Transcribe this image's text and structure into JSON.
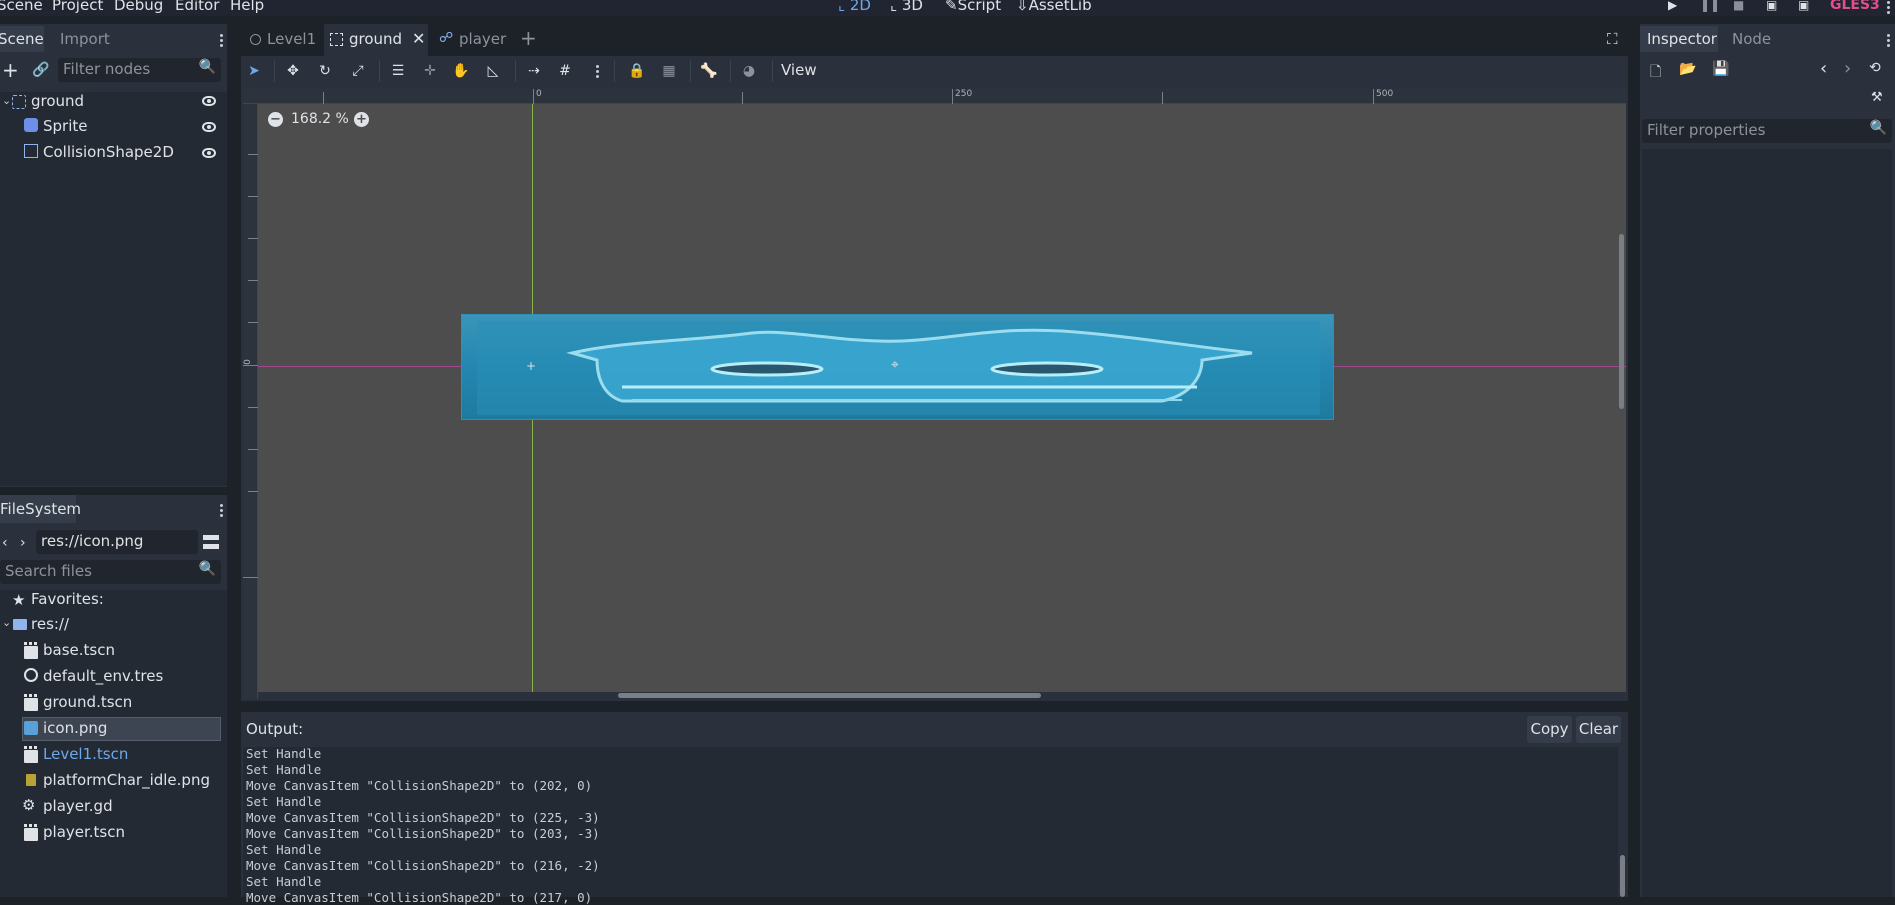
{
  "menubar": {
    "menus": [
      "Scene",
      "Project",
      "Debug",
      "Editor",
      "Help"
    ],
    "modes": {
      "d2": "2D",
      "d3": "3D",
      "script": "Script",
      "assetlib": "AssetLib"
    },
    "renderer": "GLES3"
  },
  "scene_dock": {
    "tabs": [
      "Scene",
      "Import"
    ],
    "filter_placeholder": "Filter nodes",
    "nodes": [
      "ground",
      "Sprite",
      "CollisionShape2D"
    ]
  },
  "editor_tabs": [
    "Level1",
    "ground",
    "player"
  ],
  "toolbar": {
    "view_label": "View"
  },
  "viewport": {
    "zoom": "168.2 %",
    "ruler_labels": [
      "0",
      "250",
      "500"
    ],
    "vruler_label": "0"
  },
  "filesystem": {
    "title": "FileSystem",
    "path": "res://icon.png",
    "search_placeholder": "Search files",
    "favorites": "Favorites:",
    "root": "res://",
    "files": [
      "base.tscn",
      "default_env.tres",
      "ground.tscn",
      "icon.png",
      "Level1.tscn",
      "platformChar_idle.png",
      "player.gd",
      "player.tscn"
    ]
  },
  "output": {
    "title": "Output:",
    "copy": "Copy",
    "clear": "Clear",
    "lines": [
      "Set Handle",
      "Set Handle",
      "Move CanvasItem \"CollisionShape2D\" to (202, 0)",
      "Set Handle",
      "Move CanvasItem \"CollisionShape2D\" to (225, -3)",
      "Move CanvasItem \"CollisionShape2D\" to (203, -3)",
      "Set Handle",
      "Move CanvasItem \"CollisionShape2D\" to (216, -2)",
      "Set Handle",
      "Move CanvasItem \"CollisionShape2D\" to (217, 0)"
    ]
  },
  "inspector": {
    "tabs": [
      "Inspector",
      "Node"
    ],
    "filter_placeholder": "Filter properties"
  },
  "colors": {
    "accent": "#6fa8e8",
    "selected_bg": "#3d4452",
    "viewport_bg": "#4d4d4d",
    "renderer": "#e0508a"
  }
}
